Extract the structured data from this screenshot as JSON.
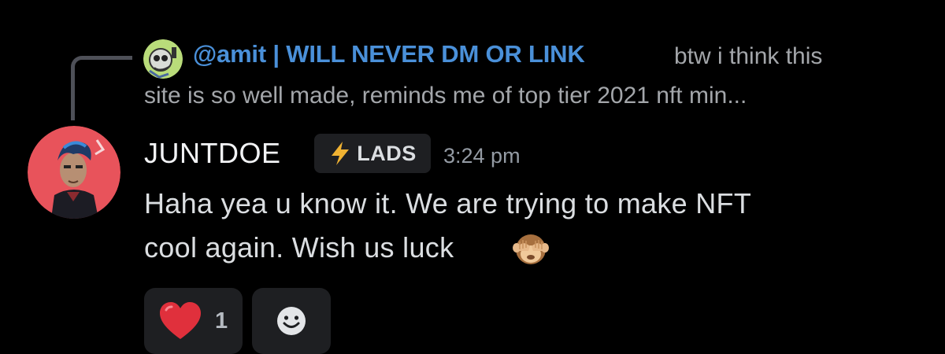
{
  "reply": {
    "author": "@amit | WILL NEVER DM OR LINK",
    "preview_line_1": "btw i think this",
    "preview_line_2": "site is so well made, reminds me of top tier 2021 nft min..."
  },
  "message": {
    "author": "JUNTDOE",
    "role_tag": "LADS",
    "role_icon": "lightning-bolt-icon",
    "timestamp": "3:24 pm",
    "text_line_1": "Haha yea u know it. We are trying to make NFT",
    "text_line_2": "cool again. Wish us luck",
    "inline_emoji": "see-no-evil-monkey-icon"
  },
  "reactions": [
    {
      "emoji": "red-heart-icon",
      "count": "1"
    }
  ],
  "add_reaction_icon": "smiley-face-icon",
  "colors": {
    "background": "#000000",
    "mention": "#4a90d9",
    "tag_background": "#1e1f22",
    "role_bolt": "#f0b232",
    "avatar_bg": "#e8535b"
  }
}
